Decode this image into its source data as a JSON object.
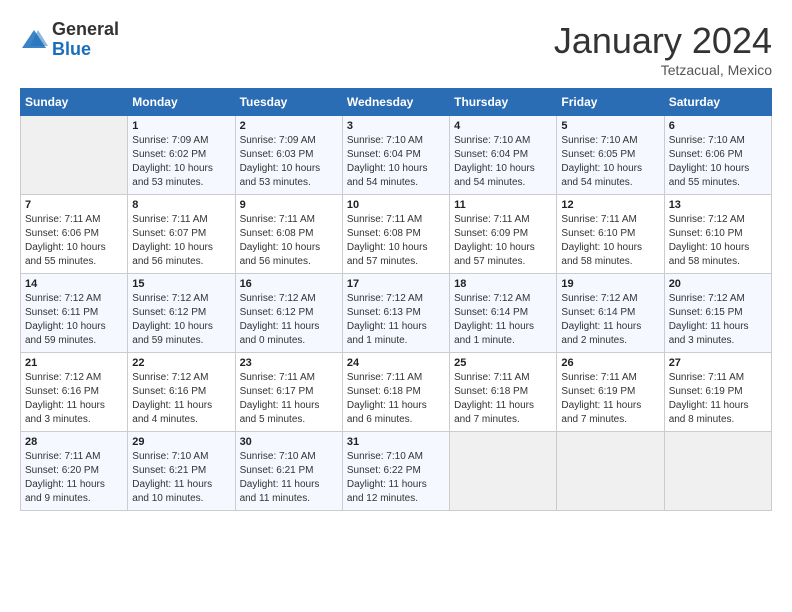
{
  "header": {
    "logo_general": "General",
    "logo_blue": "Blue",
    "month_title": "January 2024",
    "location": "Tetzacual, Mexico"
  },
  "days_of_week": [
    "Sunday",
    "Monday",
    "Tuesday",
    "Wednesday",
    "Thursday",
    "Friday",
    "Saturday"
  ],
  "weeks": [
    [
      {
        "day": "",
        "info": ""
      },
      {
        "day": "1",
        "info": "Sunrise: 7:09 AM\nSunset: 6:02 PM\nDaylight: 10 hours and 53 minutes."
      },
      {
        "day": "2",
        "info": "Sunrise: 7:09 AM\nSunset: 6:03 PM\nDaylight: 10 hours and 53 minutes."
      },
      {
        "day": "3",
        "info": "Sunrise: 7:10 AM\nSunset: 6:04 PM\nDaylight: 10 hours and 54 minutes."
      },
      {
        "day": "4",
        "info": "Sunrise: 7:10 AM\nSunset: 6:04 PM\nDaylight: 10 hours and 54 minutes."
      },
      {
        "day": "5",
        "info": "Sunrise: 7:10 AM\nSunset: 6:05 PM\nDaylight: 10 hours and 54 minutes."
      },
      {
        "day": "6",
        "info": "Sunrise: 7:10 AM\nSunset: 6:06 PM\nDaylight: 10 hours and 55 minutes."
      }
    ],
    [
      {
        "day": "7",
        "info": "Sunrise: 7:11 AM\nSunset: 6:06 PM\nDaylight: 10 hours and 55 minutes."
      },
      {
        "day": "8",
        "info": "Sunrise: 7:11 AM\nSunset: 6:07 PM\nDaylight: 10 hours and 56 minutes."
      },
      {
        "day": "9",
        "info": "Sunrise: 7:11 AM\nSunset: 6:08 PM\nDaylight: 10 hours and 56 minutes."
      },
      {
        "day": "10",
        "info": "Sunrise: 7:11 AM\nSunset: 6:08 PM\nDaylight: 10 hours and 57 minutes."
      },
      {
        "day": "11",
        "info": "Sunrise: 7:11 AM\nSunset: 6:09 PM\nDaylight: 10 hours and 57 minutes."
      },
      {
        "day": "12",
        "info": "Sunrise: 7:11 AM\nSunset: 6:10 PM\nDaylight: 10 hours and 58 minutes."
      },
      {
        "day": "13",
        "info": "Sunrise: 7:12 AM\nSunset: 6:10 PM\nDaylight: 10 hours and 58 minutes."
      }
    ],
    [
      {
        "day": "14",
        "info": "Sunrise: 7:12 AM\nSunset: 6:11 PM\nDaylight: 10 hours and 59 minutes."
      },
      {
        "day": "15",
        "info": "Sunrise: 7:12 AM\nSunset: 6:12 PM\nDaylight: 10 hours and 59 minutes."
      },
      {
        "day": "16",
        "info": "Sunrise: 7:12 AM\nSunset: 6:12 PM\nDaylight: 11 hours and 0 minutes."
      },
      {
        "day": "17",
        "info": "Sunrise: 7:12 AM\nSunset: 6:13 PM\nDaylight: 11 hours and 1 minute."
      },
      {
        "day": "18",
        "info": "Sunrise: 7:12 AM\nSunset: 6:14 PM\nDaylight: 11 hours and 1 minute."
      },
      {
        "day": "19",
        "info": "Sunrise: 7:12 AM\nSunset: 6:14 PM\nDaylight: 11 hours and 2 minutes."
      },
      {
        "day": "20",
        "info": "Sunrise: 7:12 AM\nSunset: 6:15 PM\nDaylight: 11 hours and 3 minutes."
      }
    ],
    [
      {
        "day": "21",
        "info": "Sunrise: 7:12 AM\nSunset: 6:16 PM\nDaylight: 11 hours and 3 minutes."
      },
      {
        "day": "22",
        "info": "Sunrise: 7:12 AM\nSunset: 6:16 PM\nDaylight: 11 hours and 4 minutes."
      },
      {
        "day": "23",
        "info": "Sunrise: 7:11 AM\nSunset: 6:17 PM\nDaylight: 11 hours and 5 minutes."
      },
      {
        "day": "24",
        "info": "Sunrise: 7:11 AM\nSunset: 6:18 PM\nDaylight: 11 hours and 6 minutes."
      },
      {
        "day": "25",
        "info": "Sunrise: 7:11 AM\nSunset: 6:18 PM\nDaylight: 11 hours and 7 minutes."
      },
      {
        "day": "26",
        "info": "Sunrise: 7:11 AM\nSunset: 6:19 PM\nDaylight: 11 hours and 7 minutes."
      },
      {
        "day": "27",
        "info": "Sunrise: 7:11 AM\nSunset: 6:19 PM\nDaylight: 11 hours and 8 minutes."
      }
    ],
    [
      {
        "day": "28",
        "info": "Sunrise: 7:11 AM\nSunset: 6:20 PM\nDaylight: 11 hours and 9 minutes."
      },
      {
        "day": "29",
        "info": "Sunrise: 7:10 AM\nSunset: 6:21 PM\nDaylight: 11 hours and 10 minutes."
      },
      {
        "day": "30",
        "info": "Sunrise: 7:10 AM\nSunset: 6:21 PM\nDaylight: 11 hours and 11 minutes."
      },
      {
        "day": "31",
        "info": "Sunrise: 7:10 AM\nSunset: 6:22 PM\nDaylight: 11 hours and 12 minutes."
      },
      {
        "day": "",
        "info": ""
      },
      {
        "day": "",
        "info": ""
      },
      {
        "day": "",
        "info": ""
      }
    ]
  ]
}
